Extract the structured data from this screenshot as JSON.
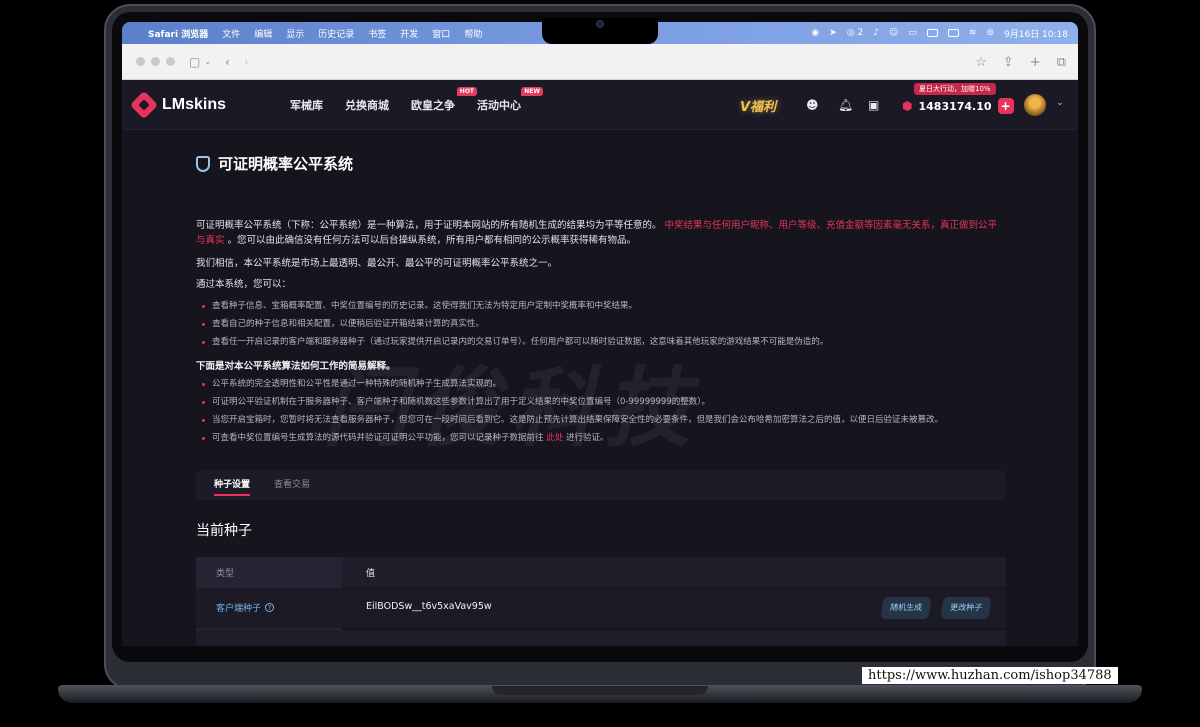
{
  "menubar": {
    "app": "Safari 浏览器",
    "items": [
      "文件",
      "编辑",
      "显示",
      "历史记录",
      "书签",
      "开发",
      "窗口",
      "帮助"
    ],
    "wechat_count": "2",
    "datetime": "9月16日 10:18"
  },
  "header": {
    "logo": "LMskins",
    "nav": [
      {
        "label": "军械库",
        "badge": ""
      },
      {
        "label": "兑换商城",
        "badge": ""
      },
      {
        "label": "欧皇之争",
        "badge": "HOT"
      },
      {
        "label": "活动中心",
        "badge": "NEW"
      }
    ],
    "promo_label": "V福利",
    "balance_promo": "夏日大行动，加赠10%",
    "balance": "1483174.10"
  },
  "page": {
    "title": "可证明概率公平系统",
    "intro_plain": "可证明概率公平系统（下称：公平系统）是一种算法，用于证明本网站的所有随机生成的结果均为平等任意的。",
    "intro_highlight": "中奖结果与任何用户昵称、用户等级、充值金额等因素毫无关系，真正做到公平与真实",
    "intro_tail": "。您可以由此确信没有任何方法可以后台操纵系统，所有用户都有相同的公示概率获得稀有物品。",
    "belief": "我们相信，本公平系统是市场上最透明、最公开、最公平的可证明概率公平系统之一。",
    "can_label": "通过本系统，您可以：",
    "can_items": [
      "查看种子信息、宝箱概率配置、中奖位置编号的历史记录。这使得我们无法为特定用户定制中奖概率和中奖结果。",
      "查看自己的种子信息和相关配置，以便稍后验证开箱结果计算的真实性。",
      "查看任一开启记录的客户端和服务器种子（通过玩家提供开启记录内的交易订单号）。任何用户都可以随时验证数据，这意味着其他玩家的游戏结果不可能是伪造的。"
    ],
    "how_label": "下面是对本公平系统算法如何工作的简易解释。",
    "how_items": [
      "公平系统的完全透明性和公平性是通过一种特殊的随机种子生成算法实现的。",
      "可证明公平验证机制在于服务器种子、客户端种子和随机数这些参数计算出了用于定义结果的中奖位置编号（0-99999999的整数）。",
      "当您开启宝箱时，您暂时将无法查看服务器种子，但您可在一段时间后看到它。这是防止预先计算出结果保障安全性的必要条件，但是我们会公布哈希加密算法之后的值，以便日后验证未被篡改。"
    ],
    "verify_pre": "可查看中奖位置编号生成算法的源代码并验证可证明公平功能，您可以记录种子数据前往",
    "verify_link": "此处",
    "verify_post": "进行验证。",
    "tabs": [
      "种子设置",
      "查看交易"
    ],
    "section_title": "当前种子",
    "table": {
      "col_type": "类型",
      "col_value": "值",
      "row_label": "客户端种子",
      "row_value": "EilBODSw__t6v5xaVav95w",
      "btn_random": "随机生成",
      "btn_change": "更改种子"
    }
  },
  "watermark": "闩俊科技",
  "source_url": "https://www.huzhan.com/ishop34788"
}
